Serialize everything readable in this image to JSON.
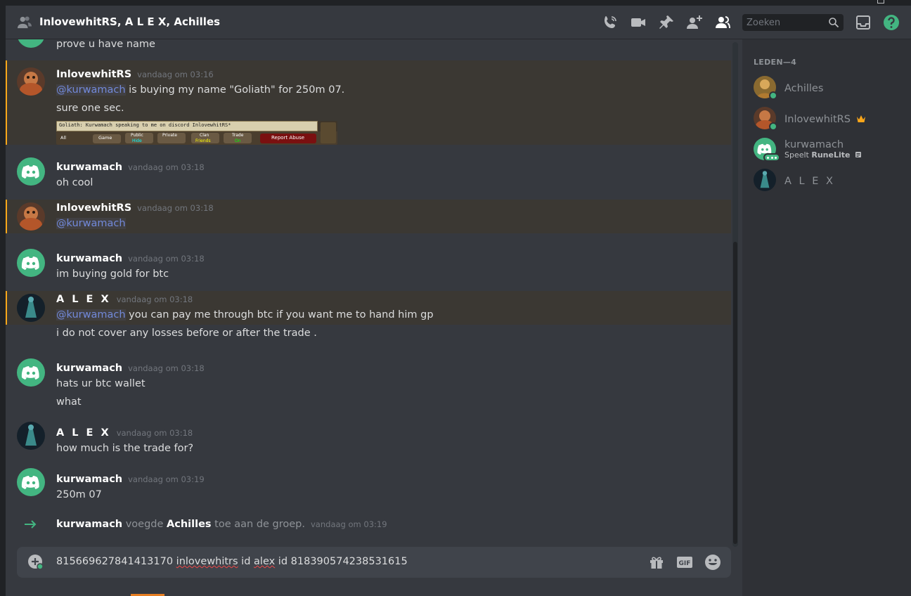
{
  "window": {
    "title": "InlovewhitRS, A L E X, Achilles"
  },
  "header": {
    "search_placeholder": "Zoeken",
    "icons": [
      "call-icon",
      "video-icon",
      "pin-icon",
      "add-member-icon",
      "members-icon",
      "search-icon",
      "inbox-icon",
      "help-icon"
    ]
  },
  "chat": {
    "partial_top": "prove u have name",
    "messages": [
      {
        "author": "InlovewhitRS",
        "time": "vandaag om 03:16",
        "mention": "@kurwamach",
        "text": " is buying my name \"Goliath\" for 250m 07.",
        "line2": "sure one sec.",
        "embed": {
          "chat_line": "Goliath: Kurwamach speaking to me on discord InlovewhitRS*",
          "tabs": [
            "All",
            "Game",
            "Public",
            "Private",
            "Clan",
            "Trade",
            "Report Abuse"
          ],
          "tab_states": [
            "",
            "",
            "Hide",
            "",
            "Friends",
            "On",
            ""
          ]
        }
      },
      {
        "author": "kurwamach",
        "time": "vandaag om 03:18",
        "text": "oh cool"
      },
      {
        "author": "InlovewhitRS",
        "time": "vandaag om 03:18",
        "mention": "@kurwamach"
      },
      {
        "author": "kurwamach",
        "time": "vandaag om 03:18",
        "text": "im buying gold for btc"
      },
      {
        "author": "A L E X",
        "time": "vandaag om 03:18",
        "mention": "@kurwamach",
        "text": " you can pay me through btc if you want me to hand him gp",
        "line2": "i do not cover any losses before or after the trade ."
      },
      {
        "author": "kurwamach",
        "time": "vandaag om 03:18",
        "text": "hats ur btc wallet",
        "line2": "what"
      },
      {
        "author": "A L E X",
        "time": "vandaag om 03:18",
        "text": "how much is the trade for?"
      },
      {
        "author": "kurwamach",
        "time": "vandaag om 03:19",
        "text": "250m 07"
      }
    ],
    "system": {
      "actor": "kurwamach",
      "verb": " voegde ",
      "target": "Achilles",
      "rest": " toe aan de groep.",
      "time": "vandaag om 03:19"
    }
  },
  "composer": {
    "parts": [
      "815669627841413170 ",
      "inlovewhitrs",
      " id ",
      "alex",
      " id 818390574238531615"
    ]
  },
  "members": {
    "header": "LEDEN—4",
    "list": [
      {
        "name": "Achilles",
        "status": "online"
      },
      {
        "name": "InlovewhitRS",
        "status": "online",
        "owner_icon": "crown-icon"
      },
      {
        "name": "kurwamach",
        "status": "mobile",
        "activity_prefix": "Speelt ",
        "activity": "RuneLite"
      },
      {
        "name": "A L E X",
        "status": "offline"
      }
    ]
  },
  "colors": {
    "mention_bar": "#faa81a",
    "mention_text": "#7289da",
    "online": "#43b581",
    "crown": "#faa61a"
  }
}
